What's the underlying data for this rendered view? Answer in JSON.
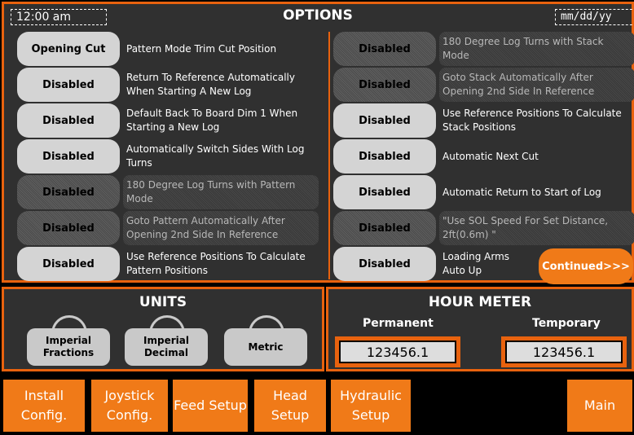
{
  "header": {
    "time": "12:00 am",
    "title": "OPTIONS",
    "date": "mm/dd/yy"
  },
  "options_left": [
    {
      "button": "Opening Cut",
      "text": "Pattern Mode Trim Cut Position",
      "dimmed": false
    },
    {
      "button": "Disabled",
      "text": "Return To Reference Automatically When Starting A New Log",
      "dimmed": false
    },
    {
      "button": "Disabled",
      "text": "Default Back To Board Dim 1 When Starting a New Log",
      "dimmed": false
    },
    {
      "button": "Disabled",
      "text": "Automatically Switch Sides With Log Turns",
      "dimmed": false
    },
    {
      "button": "Disabled",
      "text": "180 Degree Log Turns with Pattern Mode",
      "dimmed": true
    },
    {
      "button": "Disabled",
      "text": "Goto Pattern Automatically After Opening 2nd Side In Reference",
      "dimmed": true
    },
    {
      "button": "Disabled",
      "text": "Use Reference Positions To Calculate Pattern Positions",
      "dimmed": false
    }
  ],
  "options_right": [
    {
      "button": "Disabled",
      "text": "180 Degree Log Turns with Stack Mode",
      "dimmed": true
    },
    {
      "button": "Disabled",
      "text": "Goto Stack Automatically After Opening 2nd Side In Reference",
      "dimmed": true
    },
    {
      "button": "Disabled",
      "text": "Use Reference Positions To Calculate Stack Positions",
      "dimmed": false
    },
    {
      "button": "Disabled",
      "text": "Automatic Next Cut",
      "dimmed": false
    },
    {
      "button": "Disabled",
      "text": "Automatic Return to Start of Log",
      "dimmed": false
    },
    {
      "button": "Disabled",
      "text": "\"Use SOL Speed For Set Distance, 2ft(0.6m) \"",
      "dimmed": true
    },
    {
      "button": "Disabled",
      "text": "Loading Arms Auto Up",
      "dimmed": false
    }
  ],
  "continued_label": "Continued>>>",
  "units": {
    "title": "UNITS",
    "options": [
      "Imperial Fractions",
      "Imperial Decimal",
      "Metric"
    ]
  },
  "hour_meter": {
    "title": "HOUR METER",
    "permanent_label": "Permanent",
    "permanent_value": "123456.1",
    "temporary_label": "Temporary",
    "temporary_value": "123456.1"
  },
  "nav": [
    "Install Config.",
    "Joystick Config.",
    "Feed Setup",
    "Head Setup",
    "Hydraulic Setup",
    "Main"
  ],
  "colors": {
    "accent": "#e8620e",
    "panel": "#303030",
    "button": "#d4d4d4"
  }
}
